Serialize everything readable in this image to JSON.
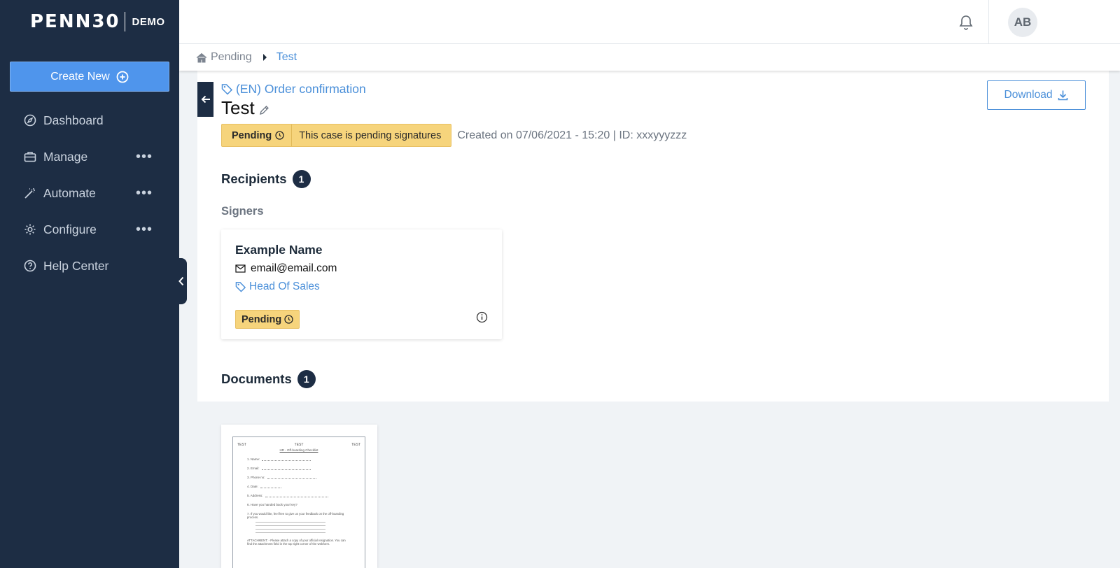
{
  "brand": {
    "name": "PENN30",
    "tag": "DEMO"
  },
  "sidebar": {
    "create_label": "Create New",
    "items": [
      {
        "label": "Dashboard",
        "icon": "compass-icon",
        "has_more": false
      },
      {
        "label": "Manage",
        "icon": "briefcase-icon",
        "has_more": true
      },
      {
        "label": "Automate",
        "icon": "magic-wand-icon",
        "has_more": true
      },
      {
        "label": "Configure",
        "icon": "gear-icon",
        "has_more": true
      },
      {
        "label": "Help Center",
        "icon": "help-circle-icon",
        "has_more": false
      }
    ],
    "more_glyph": "•••"
  },
  "header": {
    "avatar_initials": "AB"
  },
  "breadcrumb": {
    "home": "Pending",
    "current": "Test"
  },
  "case": {
    "type": "(EN) Order confirmation",
    "title": "Test",
    "status": "Pending",
    "status_message": "This case is pending signatures",
    "meta": "Created on 07/06/2021 - 15:20 | ID:  xxxyyyzzz",
    "download_label": "Download"
  },
  "recipients": {
    "title": "Recipients",
    "count": "1",
    "group": "Signers",
    "signer": {
      "name": "Example Name",
      "email": "email@email.com",
      "role": "Head Of Sales",
      "status": "Pending"
    }
  },
  "documents": {
    "title": "Documents",
    "count": "1",
    "preview": {
      "header_left": "TEST",
      "header_center": "TEST",
      "header_right": "TEST",
      "subtitle": "HR - Off-boarding Checklist",
      "fields": [
        "1.  Name:",
        "2.  Email:",
        "3.  Phone no:",
        "4.  Date:",
        "5.  Address:",
        "6.  Have you handed back your key?"
      ],
      "question": "7.  If you would like, feel free to give us your feedback on the off-boarding process.",
      "attachment": "ATTACHMENT: - Please attach a copy of your official resignation. You can find the attachment field in the top right corner of the webform."
    }
  },
  "colors": {
    "sidebar_bg": "#1d2d44",
    "accent": "#4f95ec",
    "link": "#4a8fd9",
    "pending": "#f6d47c"
  }
}
